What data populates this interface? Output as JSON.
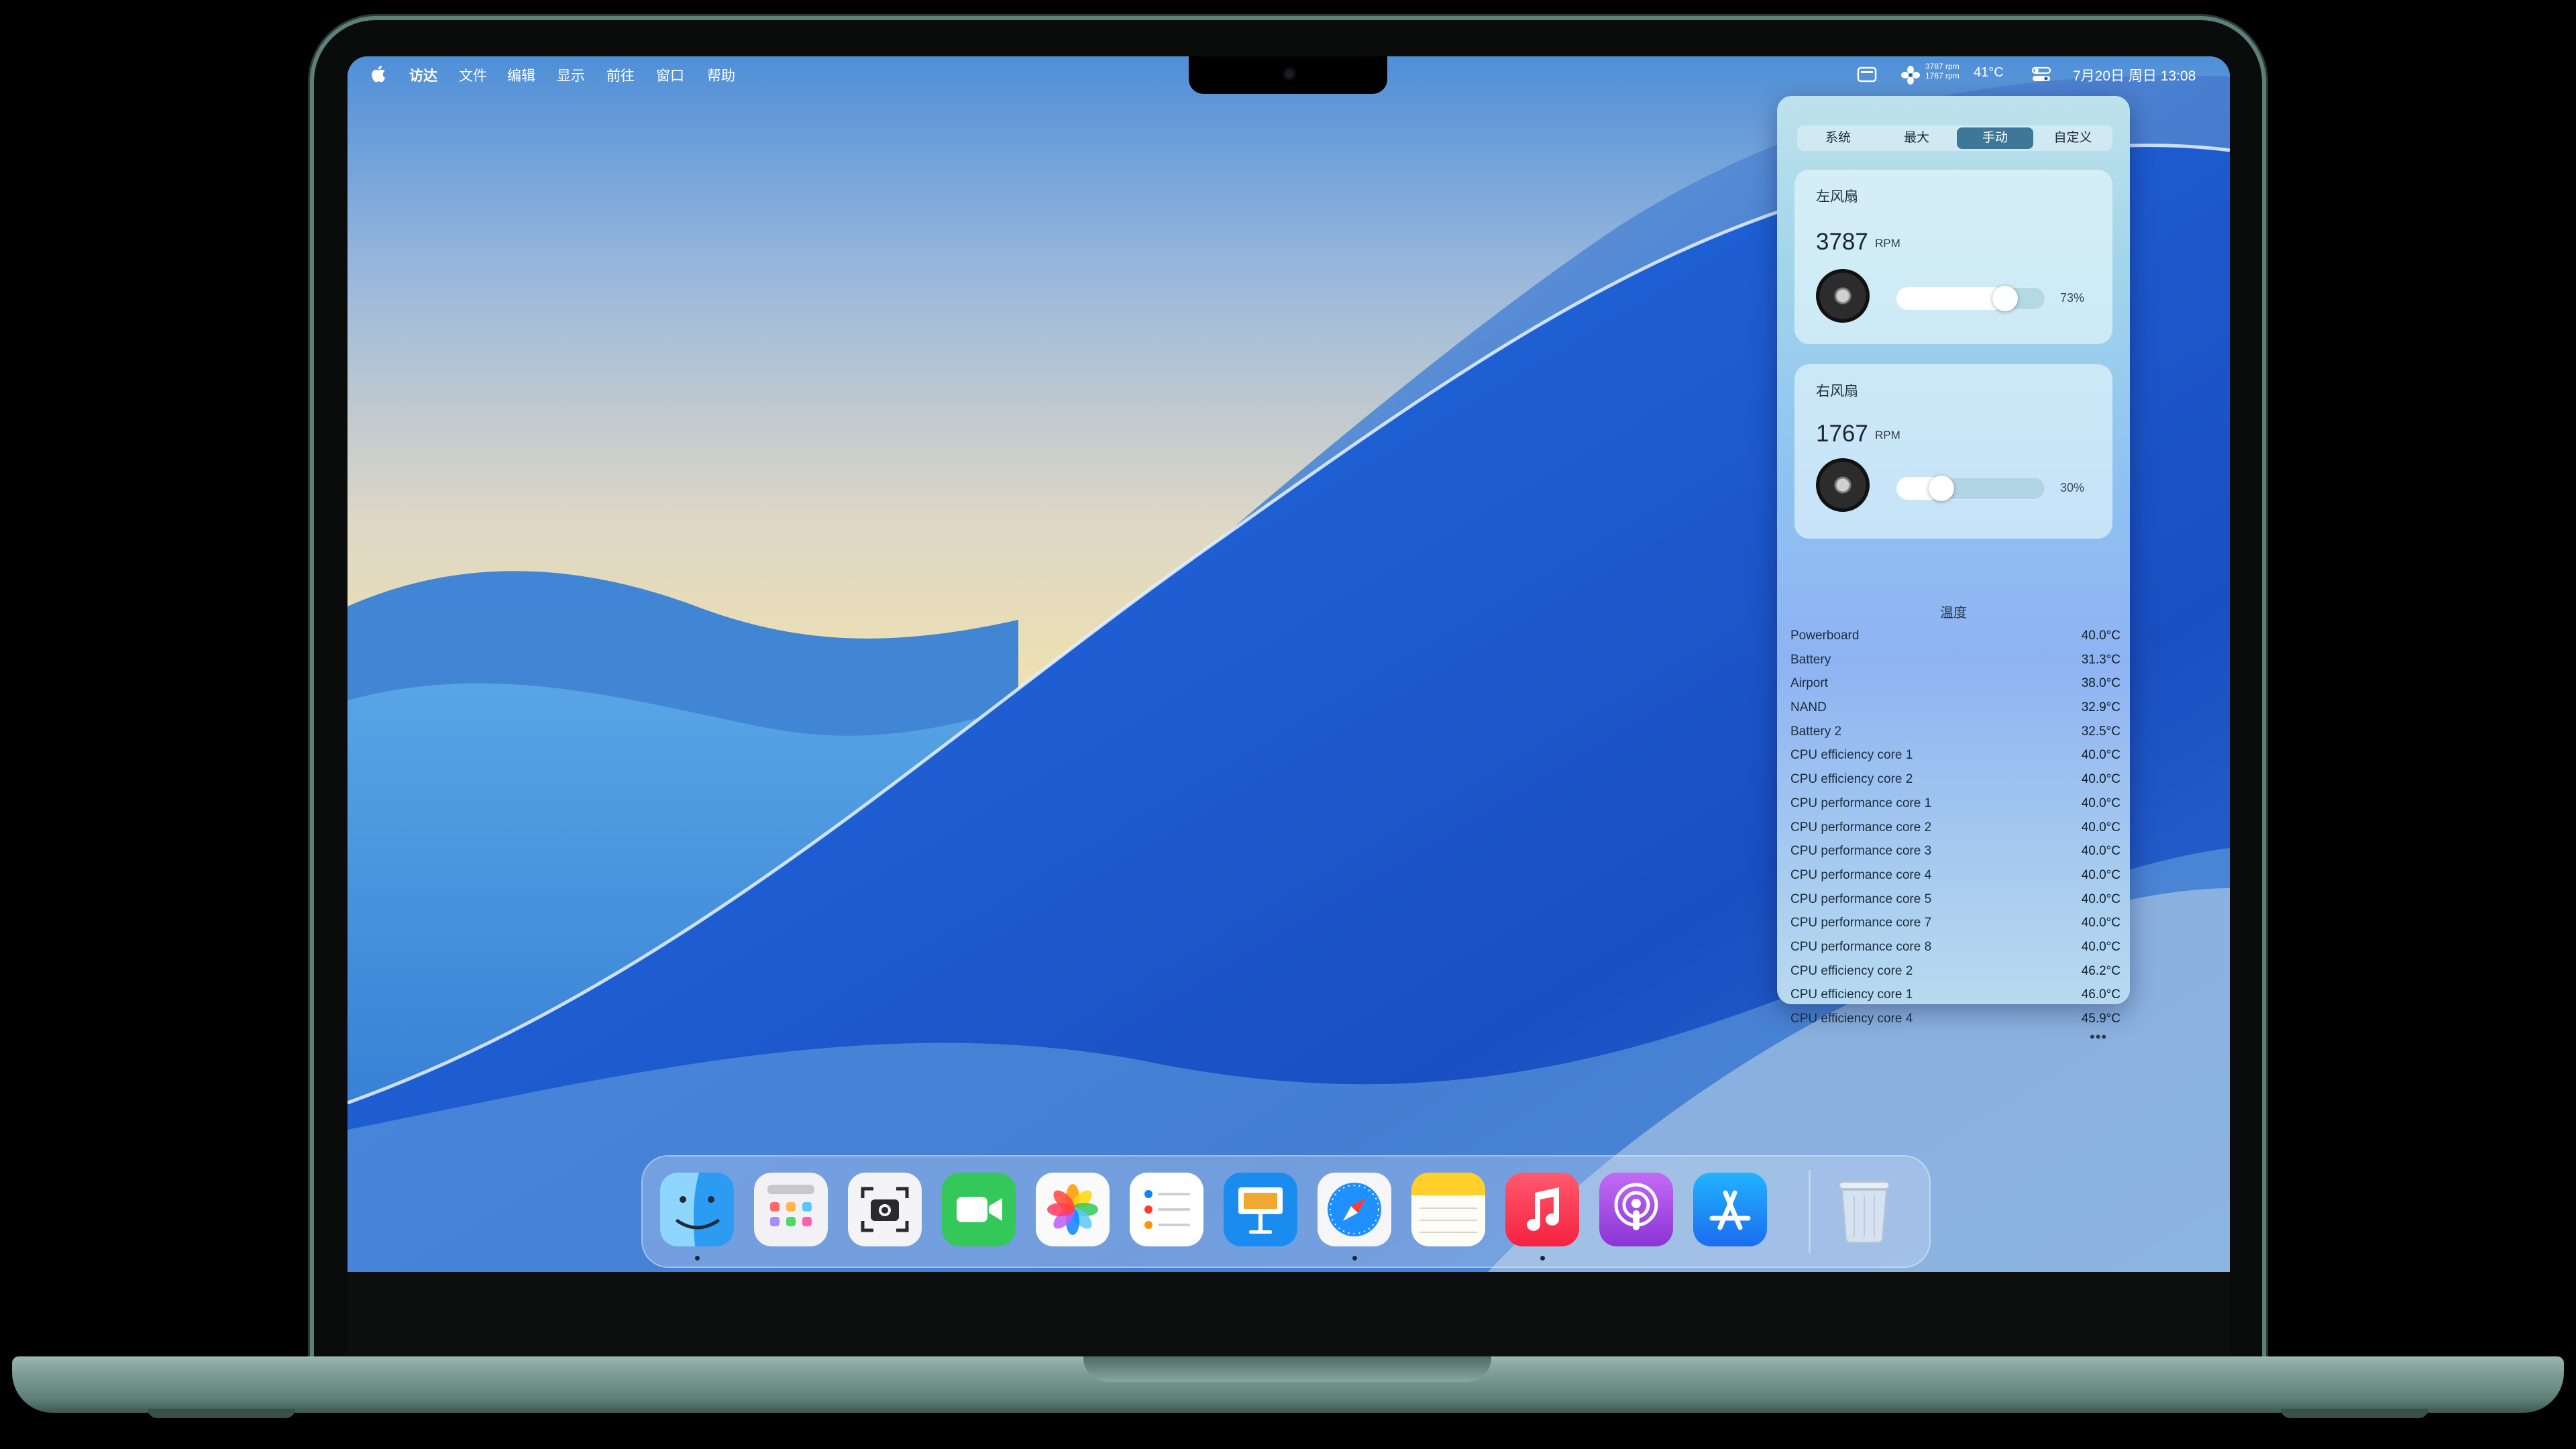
{
  "menubar": {
    "app_name": "访达",
    "items": [
      "文件",
      "编辑",
      "显示",
      "前往",
      "窗口",
      "帮助"
    ],
    "fan_rpm_line1": "3787 rpm",
    "fan_rpm_line2": "1767 rpm",
    "temperature": "41°C",
    "datetime": "7月20日 周日  13:08"
  },
  "fan_panel": {
    "modes": [
      "系统",
      "最大",
      "手动",
      "自定义"
    ],
    "active_mode": "手动",
    "fans": [
      {
        "name": "左风扇",
        "rpm": "3787",
        "unit": "RPM",
        "percent_label": "73%",
        "level": 0.73
      },
      {
        "name": "右风扇",
        "rpm": "1767",
        "unit": "RPM",
        "percent_label": "30%",
        "level": 0.3
      }
    ],
    "temperature_heading": "温度",
    "temperatures": [
      {
        "name": "Powerboard",
        "value": "40.0°C"
      },
      {
        "name": "Battery",
        "value": "31.3°C"
      },
      {
        "name": "Airport",
        "value": "38.0°C"
      },
      {
        "name": "NAND",
        "value": "32.9°C"
      },
      {
        "name": "Battery 2",
        "value": "32.5°C"
      },
      {
        "name": "CPU efficiency core 1",
        "value": "40.0°C"
      },
      {
        "name": "CPU efficiency core 2",
        "value": "40.0°C"
      },
      {
        "name": "CPU performance core 1",
        "value": "40.0°C"
      },
      {
        "name": "CPU performance core 2",
        "value": "40.0°C"
      },
      {
        "name": "CPU performance core 3",
        "value": "40.0°C"
      },
      {
        "name": "CPU performance core 4",
        "value": "40.0°C"
      },
      {
        "name": "CPU performance core 5",
        "value": "40.0°C"
      },
      {
        "name": "CPU performance core 7",
        "value": "40.0°C"
      },
      {
        "name": "CPU performance core 8",
        "value": "40.0°C"
      },
      {
        "name": "CPU efficiency core 2",
        "value": "46.2°C"
      },
      {
        "name": "CPU efficiency core 1",
        "value": "46.0°C"
      },
      {
        "name": "CPU efficiency core 4",
        "value": "45.9°C"
      }
    ],
    "more_label": "•••"
  },
  "dock": {
    "apps": [
      {
        "id": "finder",
        "running": true
      },
      {
        "id": "launchpad",
        "running": false
      },
      {
        "id": "screenshot",
        "running": false
      },
      {
        "id": "facetime",
        "running": false
      },
      {
        "id": "photos",
        "running": false
      },
      {
        "id": "reminders",
        "running": false
      },
      {
        "id": "keynote",
        "running": false
      },
      {
        "id": "safari",
        "running": true
      },
      {
        "id": "notes",
        "running": false
      },
      {
        "id": "music",
        "running": true
      },
      {
        "id": "podcasts",
        "running": false
      },
      {
        "id": "app-store",
        "running": false
      }
    ],
    "trash": {
      "id": "trash"
    }
  }
}
